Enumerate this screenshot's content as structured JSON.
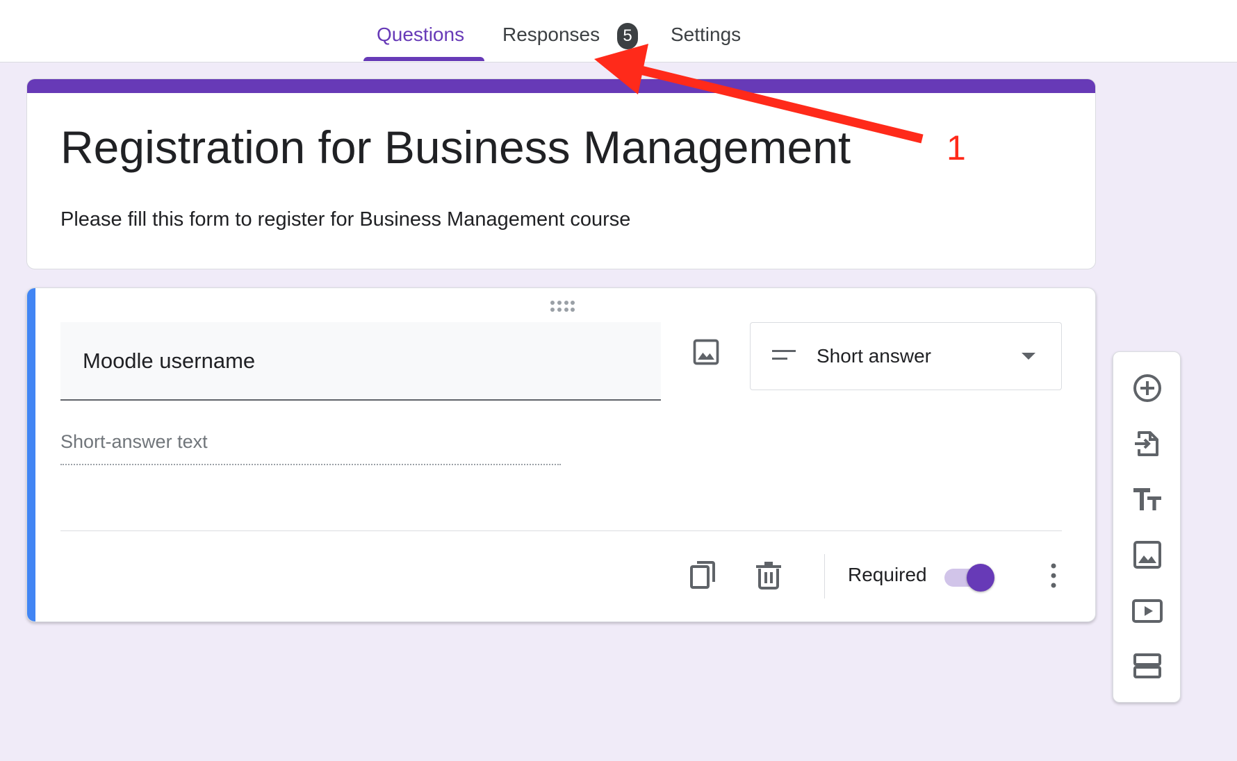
{
  "tabs": {
    "questions": "Questions",
    "responses": "Responses",
    "responses_count": "5",
    "settings": "Settings"
  },
  "form": {
    "title": "Registration for Business Management",
    "description": "Please fill this form to register for Business Management course"
  },
  "question": {
    "title": "Moodle username",
    "type": "Short answer",
    "answer_placeholder": "Short-answer text",
    "required_label": "Required",
    "required": true
  },
  "sidebar_tools": [
    "add-question",
    "import-questions",
    "add-title-and-description",
    "add-image",
    "add-video",
    "add-section"
  ],
  "annotation": {
    "number": "1"
  },
  "colors": {
    "accent": "#673ab7",
    "active_question": "#4285f4",
    "background": "#f0ebf8",
    "annotation": "#ff2a1a"
  }
}
